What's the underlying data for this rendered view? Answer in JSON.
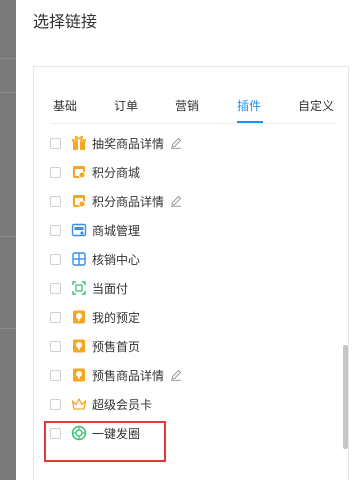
{
  "dialog": {
    "title": "选择链接"
  },
  "tabs": [
    {
      "label": "基础",
      "active": false
    },
    {
      "label": "订单",
      "active": false
    },
    {
      "label": "营销",
      "active": false
    },
    {
      "label": "插件",
      "active": true
    },
    {
      "label": "自定义",
      "active": false
    }
  ],
  "items": [
    {
      "label": "抽奖商品详情",
      "icon": "gift-icon",
      "editable": true
    },
    {
      "label": "积分商城",
      "icon": "points-mall-icon",
      "editable": false
    },
    {
      "label": "积分商品详情",
      "icon": "points-goods-icon",
      "editable": true
    },
    {
      "label": "商城管理",
      "icon": "store-manage-icon",
      "editable": false
    },
    {
      "label": "核销中心",
      "icon": "verify-center-icon",
      "editable": false
    },
    {
      "label": "当面付",
      "icon": "scan-pay-icon",
      "editable": false
    },
    {
      "label": "我的预定",
      "icon": "reservation-icon",
      "editable": false
    },
    {
      "label": "预售首页",
      "icon": "presale-home-icon",
      "editable": false
    },
    {
      "label": "预售商品详情",
      "icon": "presale-goods-icon",
      "editable": true
    },
    {
      "label": "超级会员卡",
      "icon": "crown-icon",
      "editable": false
    },
    {
      "label": "一键发圈",
      "icon": "moments-icon",
      "editable": false
    }
  ],
  "colors": {
    "accent": "#1890ff",
    "highlight": "#e53935",
    "orange": "#f5a623",
    "blue": "#3a8ee6",
    "green": "#37c26b"
  }
}
